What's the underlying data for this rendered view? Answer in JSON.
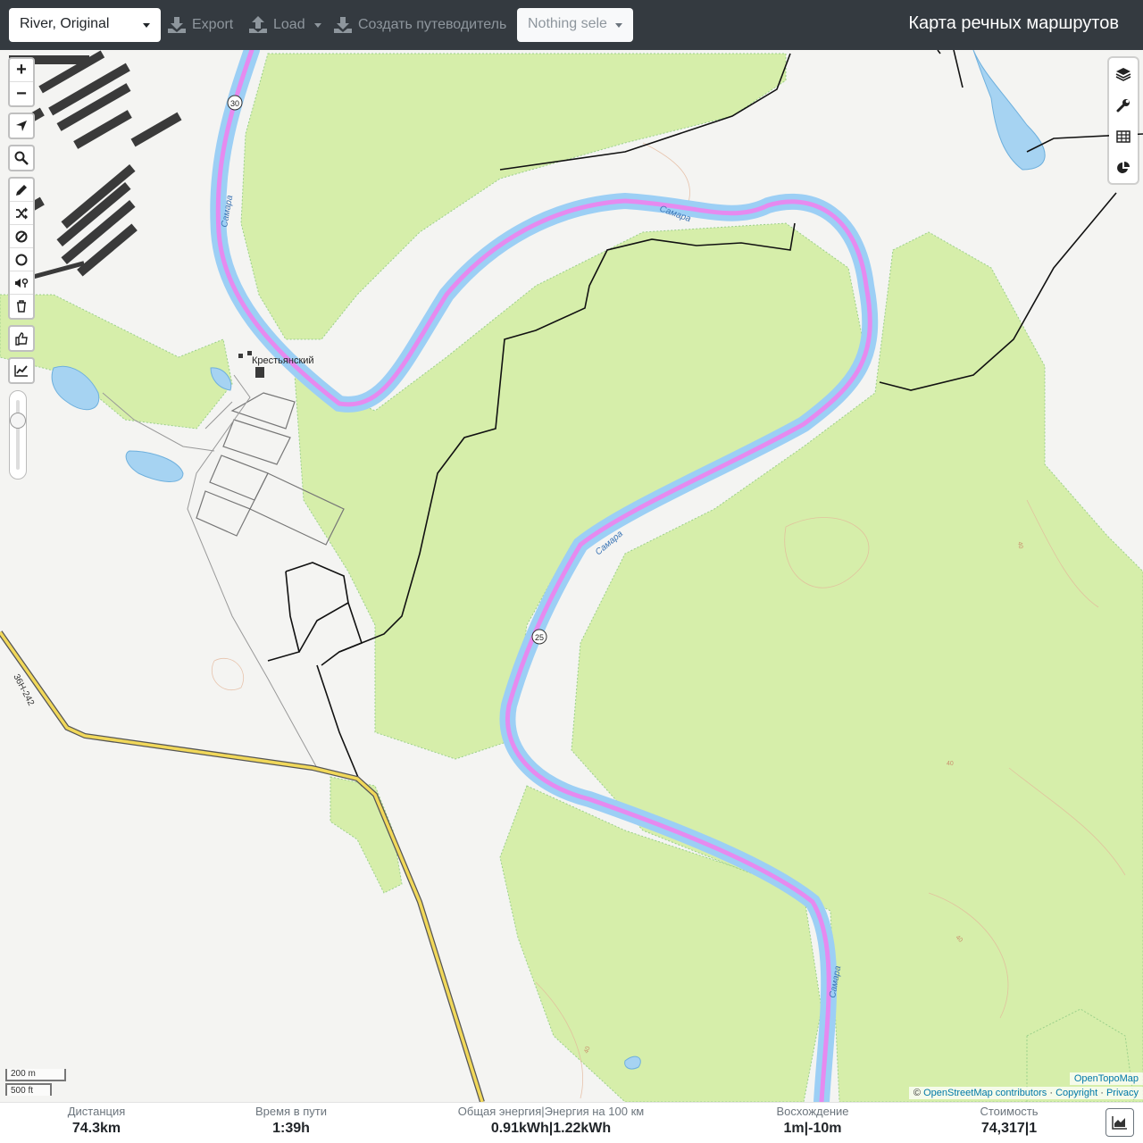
{
  "header": {
    "profile": "River, Original",
    "export_label": "Export",
    "load_label": "Load",
    "guide_label": "Создать путеводитель",
    "nothing_selected": "Nothing sele",
    "title": "Карта речных маршрутов"
  },
  "map": {
    "river_labels": [
      "Самара",
      "Самара",
      "Самара",
      "Самара"
    ],
    "village": "Крестьянский",
    "road_ref": "36Н-242",
    "waypoints": [
      "30",
      "25"
    ],
    "contours": [
      "40",
      "40",
      "40",
      "40"
    ],
    "scale_metric": "200 m",
    "scale_imperial": "500 ft",
    "attribution_tile": "OpenTopoMap",
    "attribution_copy": "©",
    "attribution_osm": "OpenStreetMap contributors",
    "attribution_sep": "·",
    "attribution_copyright": "Copyright",
    "attribution_privacy": "Privacy",
    "zoom_slider_level": 0.2
  },
  "controls": {
    "left": [
      "zoom-in-icon",
      "zoom-out-icon",
      "locate-icon",
      "search-icon",
      "draw-icon",
      "shuffle-icon",
      "no-entry-icon",
      "circle-icon",
      "poi-icon",
      "trash-icon",
      "thumb-icon",
      "elevation-icon"
    ],
    "right": [
      "layers-icon",
      "wrench-icon",
      "table-icon",
      "pie-chart-icon"
    ],
    "zoom_in": "+",
    "zoom_out": "−"
  },
  "stats": {
    "distance_label": "Дистанция",
    "distance_value": "74.3",
    "distance_unit": "km",
    "time_label": "Время в пути",
    "time_value": "1:39",
    "time_unit": "h",
    "energy_label": "Общая энергия|Энергия на 100 км",
    "energy_value": "0.91",
    "energy_unit": "kWh",
    "energy_sep": "|",
    "energy100_value": "1.22",
    "energy100_unit": "kWh",
    "ascent_label": "Восхождение",
    "ascent_value": "1",
    "ascent_unit": "m",
    "ascent_sep": "|",
    "descent_value": "-10",
    "descent_unit": "m",
    "cost_label": "Стоимость",
    "cost_value": "74,317",
    "cost_sep": "|",
    "cost_count": "1"
  },
  "colors": {
    "route": "#e68aef",
    "river": "#9ccff5",
    "forest": "#d6eeaa",
    "road": "#f1d85a",
    "topbar": "#343a40"
  }
}
